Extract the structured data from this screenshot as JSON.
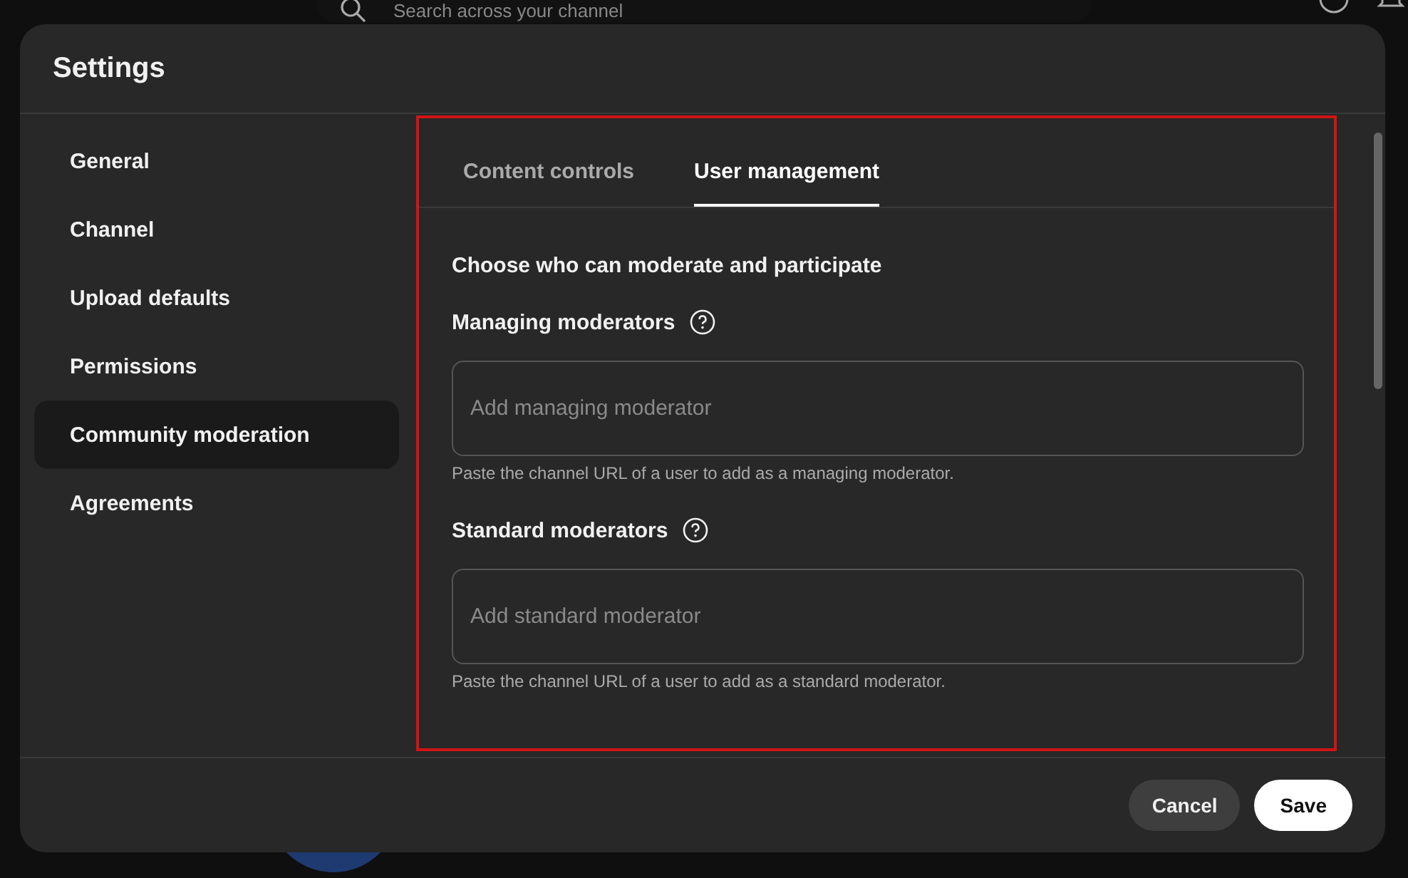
{
  "background": {
    "search": {
      "placeholder": "Search across your channel"
    }
  },
  "dialog": {
    "title": "Settings",
    "sidebar": {
      "items": [
        {
          "label": "General",
          "selected": false
        },
        {
          "label": "Channel",
          "selected": false
        },
        {
          "label": "Upload defaults",
          "selected": false
        },
        {
          "label": "Permissions",
          "selected": false
        },
        {
          "label": "Community moderation",
          "selected": true
        },
        {
          "label": "Agreements",
          "selected": false
        }
      ]
    },
    "tabs": [
      {
        "label": "Content controls",
        "selected": false
      },
      {
        "label": "User management",
        "selected": true
      }
    ],
    "section_heading": "Choose who can moderate and participate",
    "fields": [
      {
        "label": "Managing moderators",
        "placeholder": "Add managing moderator",
        "hint": "Paste the channel URL of a user to add as a managing moderator."
      },
      {
        "label": "Standard moderators",
        "placeholder": "Add standard moderator",
        "hint": "Paste the channel URL of a user to add as a standard moderator."
      }
    ],
    "buttons": [
      {
        "label": "Cancel",
        "kind": "secondary"
      },
      {
        "label": "Save",
        "kind": "primary"
      }
    ]
  }
}
